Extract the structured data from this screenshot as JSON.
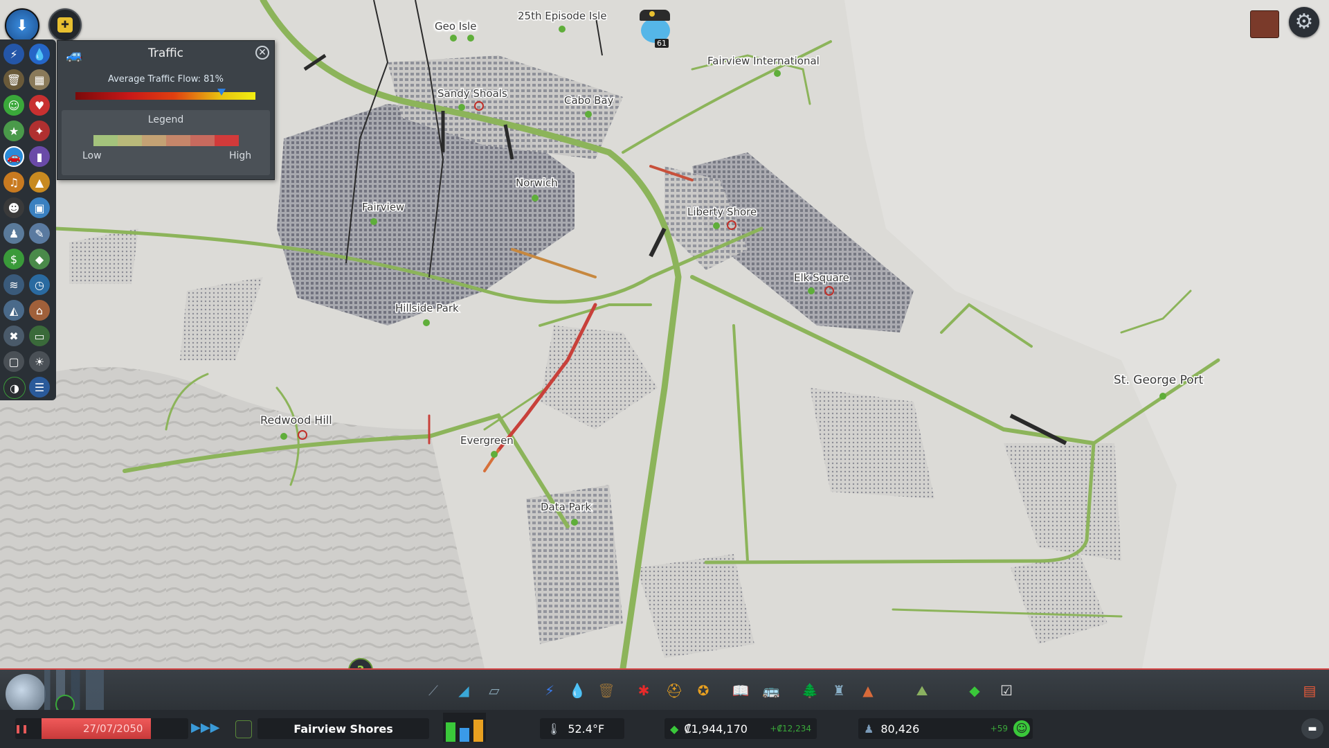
{
  "panel": {
    "title": "Traffic",
    "flow_label": "Average Traffic Flow: 81%",
    "flow_percent": 81,
    "legend_title": "Legend",
    "legend_low": "Low",
    "legend_high": "High",
    "legend_colors": [
      "#a4c37c",
      "#b9b97a",
      "#c4a274",
      "#c6866a",
      "#c86a5e",
      "#d23a3a"
    ]
  },
  "districts": [
    {
      "label": "Geo Isle"
    },
    {
      "label": "25th Episode Isle"
    },
    {
      "label": "Fairview International"
    },
    {
      "label": "Sandy Shoals"
    },
    {
      "label": "Cabo Bay"
    },
    {
      "label": "Norwich"
    },
    {
      "label": "Fairview"
    },
    {
      "label": "Liberty Shore"
    },
    {
      "label": "Elk Square"
    },
    {
      "label": "Hillside Park"
    },
    {
      "label": "St. George Port"
    },
    {
      "label": "Redwood Hill"
    },
    {
      "label": "Evergreen"
    },
    {
      "label": "Data Park"
    }
  ],
  "mascot_badge": "61",
  "bottom": {
    "date": "27/07/2050",
    "city_name": "Fairview Shores",
    "temperature": "52.4°F",
    "money": "₡1,944,170",
    "money_delta": "+₡12,234",
    "population": "80,426",
    "population_delta": "+59"
  },
  "colors": {
    "road_green": "#8cb45a",
    "congested_red": "#c8403a",
    "panel_bg": "#3c4248",
    "bar_bg": "#2b3036",
    "accent_red": "#d64545"
  }
}
